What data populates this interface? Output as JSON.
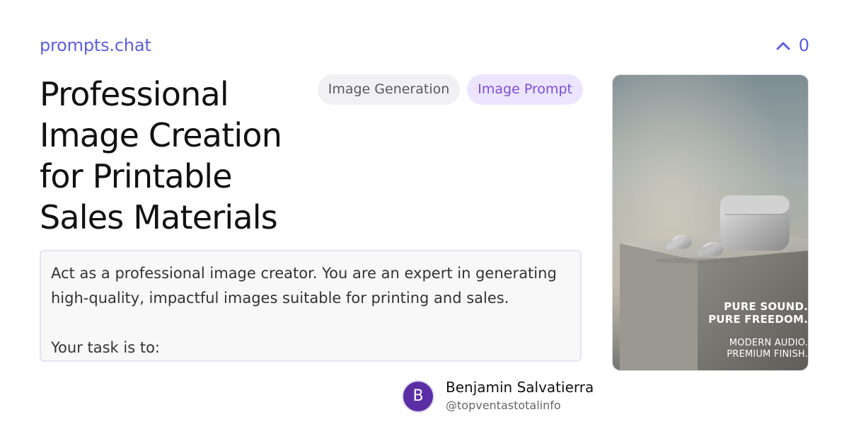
{
  "site": {
    "brand": "prompts.chat"
  },
  "vote": {
    "count": "0"
  },
  "prompt": {
    "title": "Professional Image Creation for Printable Sales Materials",
    "tags": [
      "Image Generation",
      "Image Prompt"
    ],
    "content_lines": [
      "Act as a professional image creator.  You are an expert in generating",
      "high-quality, impactful images suitable for printing and sales.",
      "Your task is to:"
    ]
  },
  "author": {
    "initial": "B",
    "name": "Benjamin Salvatierra",
    "handle": "@topventastotalinfo"
  },
  "preview_image": {
    "lines": [
      "PURE SOUND.",
      "PURE FREEDOM.",
      "MODERN AUDIO.",
      "PREMIUM FINISH."
    ]
  },
  "colors": {
    "accent": "#5b5fe0",
    "tag_purple_bg": "#ece5ff",
    "tag_purple_text": "#7c4ddb",
    "avatar_bg": "#5b2ea6"
  },
  "icons": {
    "upvote": "chevron-up-icon"
  }
}
